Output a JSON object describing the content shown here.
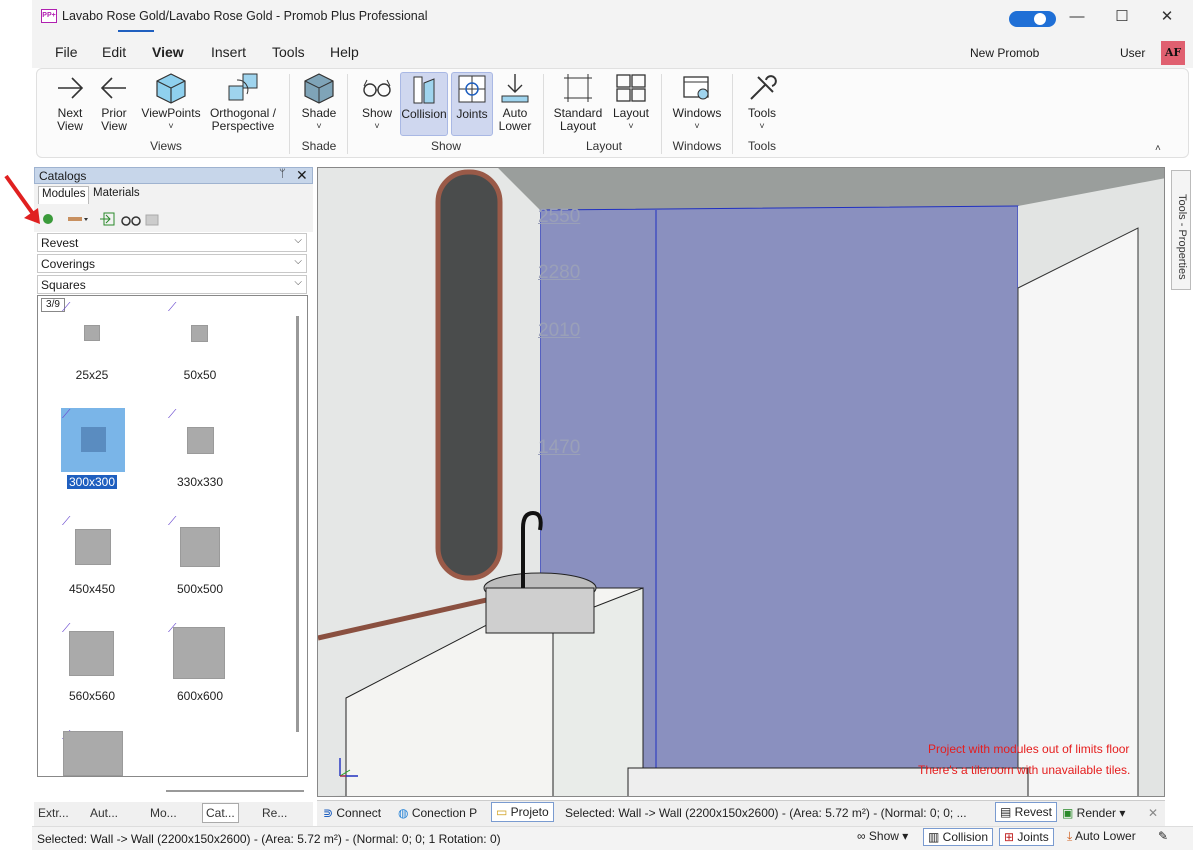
{
  "window": {
    "title": "Lavabo Rose Gold/Lavabo Rose Gold - Promob Plus Professional",
    "minimize": "—",
    "maximize": "☐",
    "close": "✕",
    "app_icon_text": "PP+"
  },
  "menu": {
    "items": [
      "File",
      "Edit",
      "View",
      "Insert",
      "Tools",
      "Help"
    ],
    "active": "View",
    "new_promob_label": "New Promob",
    "new_promob_on": true,
    "user_label": "User",
    "avatar": "AF"
  },
  "ribbon": {
    "buttons": [
      {
        "label1": "Next",
        "label2": "View",
        "icon": "arrow-right-icon"
      },
      {
        "label1": "Prior",
        "label2": "View",
        "icon": "arrow-left-icon"
      },
      {
        "label1": "ViewPoints",
        "label2": "˅",
        "icon": "cube-icon"
      },
      {
        "label1": "Orthogonal /",
        "label2": "Perspective",
        "icon": "perspective-cubes-icon"
      },
      {
        "label1": "Shade",
        "label2": "˅",
        "icon": "shade-cube-icon"
      },
      {
        "label1": "Show",
        "label2": "˅",
        "icon": "glasses-icon"
      },
      {
        "label1": "Collision",
        "label2": "",
        "icon": "collision-icon",
        "active": true
      },
      {
        "label1": "Joints",
        "label2": "",
        "icon": "joints-icon",
        "active": true
      },
      {
        "label1": "Auto",
        "label2": "Lower",
        "icon": "auto-lower-icon"
      },
      {
        "label1": "Standard",
        "label2": "Layout",
        "icon": "standard-layout-icon"
      },
      {
        "label1": "Layout",
        "label2": "˅",
        "icon": "layout-grid-icon"
      },
      {
        "label1": "Windows",
        "label2": "˅",
        "icon": "windows-icon"
      },
      {
        "label1": "Tools",
        "label2": "˅",
        "icon": "tools-icon"
      }
    ],
    "groups": [
      "Views",
      "Shade",
      "Show",
      "Layout",
      "Windows",
      "Tools"
    ],
    "collapse": "˄"
  },
  "catalogs": {
    "title": "Catalogs",
    "pin": "📌",
    "close": "✕",
    "tabs": [
      "Modules",
      "Materials"
    ],
    "active_tab": "Modules",
    "dropdowns": [
      "Revest",
      "Coverings",
      "Squares"
    ],
    "page_counter": "3/9",
    "items": [
      {
        "label": "25x25",
        "selected": false
      },
      {
        "label": "50x50",
        "selected": false
      },
      {
        "label": "300x300",
        "selected": true
      },
      {
        "label": "330x330",
        "selected": false
      },
      {
        "label": "450x450",
        "selected": false
      },
      {
        "label": "500x500",
        "selected": false
      },
      {
        "label": "560x560",
        "selected": false
      },
      {
        "label": "600x600",
        "selected": false
      },
      {
        "label": "",
        "selected": false
      }
    ]
  },
  "viewport": {
    "dimensions": [
      "2550",
      "2280",
      "2010",
      "1470"
    ],
    "warnings": [
      "Project with modules out of limits floor",
      "There's a tileroom with unavailable tiles."
    ],
    "wall_color": "#8a90bf"
  },
  "properties_strip": {
    "label": "Tools - Properties"
  },
  "bottom_left_tabs": [
    "Extr...",
    "Aut...",
    "Mo...",
    "Cat...",
    "Re..."
  ],
  "bottom_tabs": {
    "connect": "Connect",
    "conection": "Conection P",
    "projeto": "Projeto",
    "selected": "Selected: Wall -> Wall (2200x150x2600) - (Area: 5.72 m²) - (Normal: 0; 0; ...",
    "revest": "Revest",
    "render": "Render",
    "close": "✕"
  },
  "statusbar": {
    "text": "Selected: Wall -> Wall (2200x150x2600) - (Area: 5.72 m²) - (Normal: 0; 0; 1 Rotation: 0)",
    "show": "Show",
    "collision": "Collision",
    "joints": "Joints",
    "auto_lower": "Auto Lower"
  }
}
